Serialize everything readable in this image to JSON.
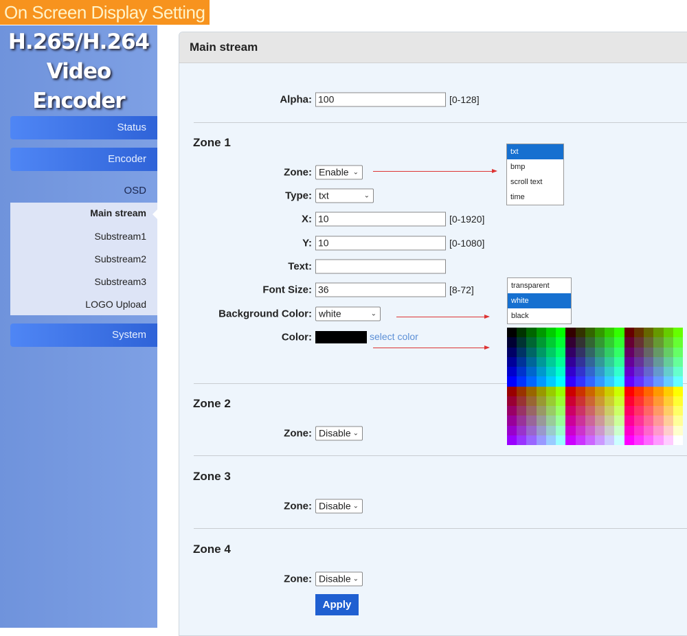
{
  "banner": "On Screen Display Setting",
  "logo": {
    "line1": "H.265/H.264",
    "line2": "Video Encoder"
  },
  "nav": {
    "status": "Status",
    "encoder": "Encoder",
    "osd": "OSD",
    "system": "System",
    "osd_items": [
      "Main stream",
      "Substream1",
      "Substream2",
      "Substream3",
      "LOGO Upload"
    ],
    "active": "Main stream"
  },
  "panel": {
    "title": "Main stream",
    "alpha": {
      "label": "Alpha:",
      "value": "100",
      "range": "[0-128]"
    },
    "zone1": {
      "title": "Zone 1",
      "zone_label": "Zone:",
      "zone_value": "Enable",
      "type_label": "Type:",
      "type_value": "txt",
      "x_label": "X:",
      "x_value": "10",
      "x_range": "[0-1920]",
      "y_label": "Y:",
      "y_value": "10",
      "y_range": "[0-1080]",
      "text_label": "Text:",
      "text_value": "",
      "font_label": "Font Size:",
      "font_value": "36",
      "font_range": "[8-72]",
      "bg_label": "Background Color:",
      "bg_value": "white",
      "color_label": "Color:",
      "color_value": "#000000",
      "select_color": "select color"
    },
    "zone2": {
      "title": "Zone 2",
      "zone_label": "Zone:",
      "zone_value": "Disable"
    },
    "zone3": {
      "title": "Zone 3",
      "zone_label": "Zone:",
      "zone_value": "Disable"
    },
    "zone4": {
      "title": "Zone 4",
      "zone_label": "Zone:",
      "zone_value": "Disable"
    },
    "apply": "Apply"
  },
  "type_options": [
    "txt",
    "bmp",
    "scroll text",
    "time"
  ],
  "type_selected": "txt",
  "bg_options": [
    "transparent",
    "white",
    "black"
  ],
  "bg_selected": "white",
  "palette_levels": [
    "00",
    "33",
    "66",
    "99",
    "CC",
    "FF"
  ],
  "colors": {
    "accent": "#1f5fd1",
    "banner": "#f7931e",
    "arrow": "#dd3333",
    "link": "#5b8fd6"
  }
}
